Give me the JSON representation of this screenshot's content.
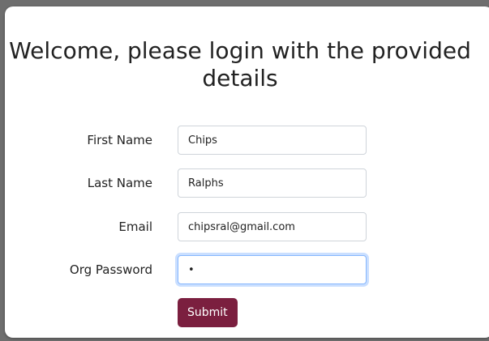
{
  "page": {
    "title": "Welcome, please login with the provided details"
  },
  "form": {
    "first_name": {
      "label": "First Name",
      "value": "Chips"
    },
    "last_name": {
      "label": "Last Name",
      "value": "Ralphs"
    },
    "email": {
      "label": "Email",
      "value": "chipsral@gmail.com"
    },
    "org_password": {
      "label": "Org Password",
      "value": "a"
    },
    "submit_label": "Submit"
  },
  "colors": {
    "accent": "#7b1f3f",
    "focus_ring": "#86b7fe"
  }
}
